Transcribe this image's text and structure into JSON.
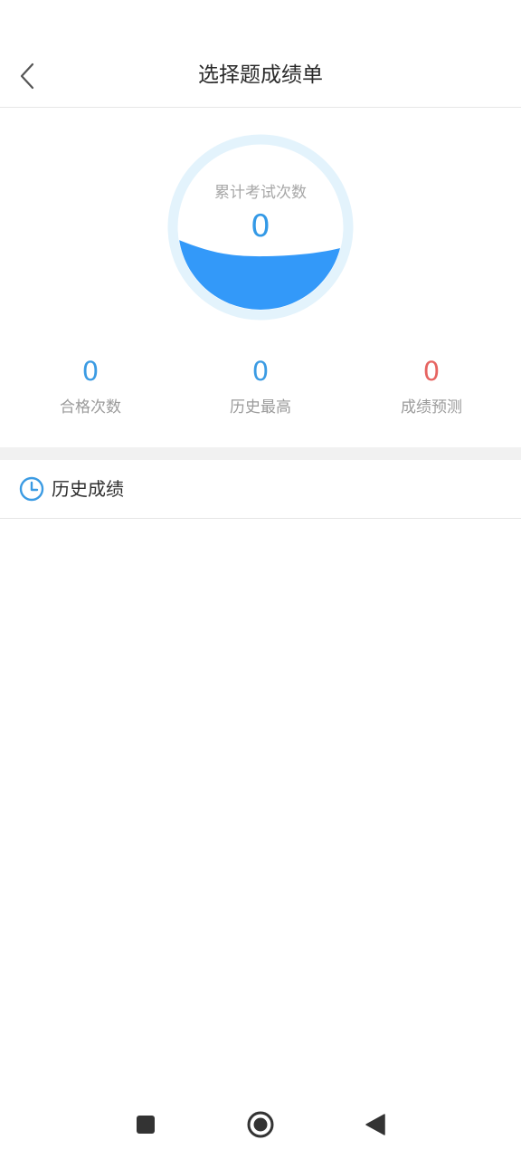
{
  "header": {
    "title": "选择题成绩单"
  },
  "gauge": {
    "label": "累计考试次数",
    "value": "0",
    "fill_fraction": 0.4,
    "colors": {
      "ring": "#e3f3fc",
      "water": "#3399f9"
    }
  },
  "stats": [
    {
      "value": "0",
      "label": "合格次数",
      "color": "#3b9be3"
    },
    {
      "value": "0",
      "label": "历史最高",
      "color": "#3b9be3"
    },
    {
      "value": "0",
      "label": "成绩预测",
      "color": "#e66461"
    }
  ],
  "history": {
    "title": "历史成绩",
    "icon": "clock-icon",
    "items": []
  },
  "navbar": {
    "icons": [
      "square-icon",
      "circle-home-icon",
      "back-triangle-icon"
    ]
  }
}
